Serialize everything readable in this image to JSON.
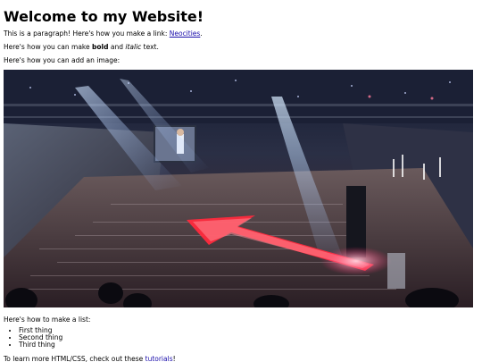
{
  "heading": "Welcome to my Website!",
  "paragraph1": {
    "text_before": "This is a paragraph! Here's how you make a link: ",
    "link_text": "Neocities",
    "text_after": "."
  },
  "paragraph2": {
    "text_before": "Here's how you can make ",
    "bold_text": "bold",
    "text_middle": " and ",
    "italic_text": "italic",
    "text_after": " text."
  },
  "paragraph3": "Here's how you can add an image:",
  "image": {
    "subject": "concert-arena-photo",
    "accent_color": "#ff2a3d"
  },
  "list_intro": "Here's how to make a list:",
  "list_items": [
    "First thing",
    "Second thing",
    "Third thing"
  ],
  "footer": {
    "text_before": "To learn more HTML/CSS, check out these ",
    "link_text": "tutorials",
    "text_after": "!"
  },
  "colors": {
    "link": "#1a0dab",
    "text": "#000000",
    "background": "#ffffff"
  }
}
